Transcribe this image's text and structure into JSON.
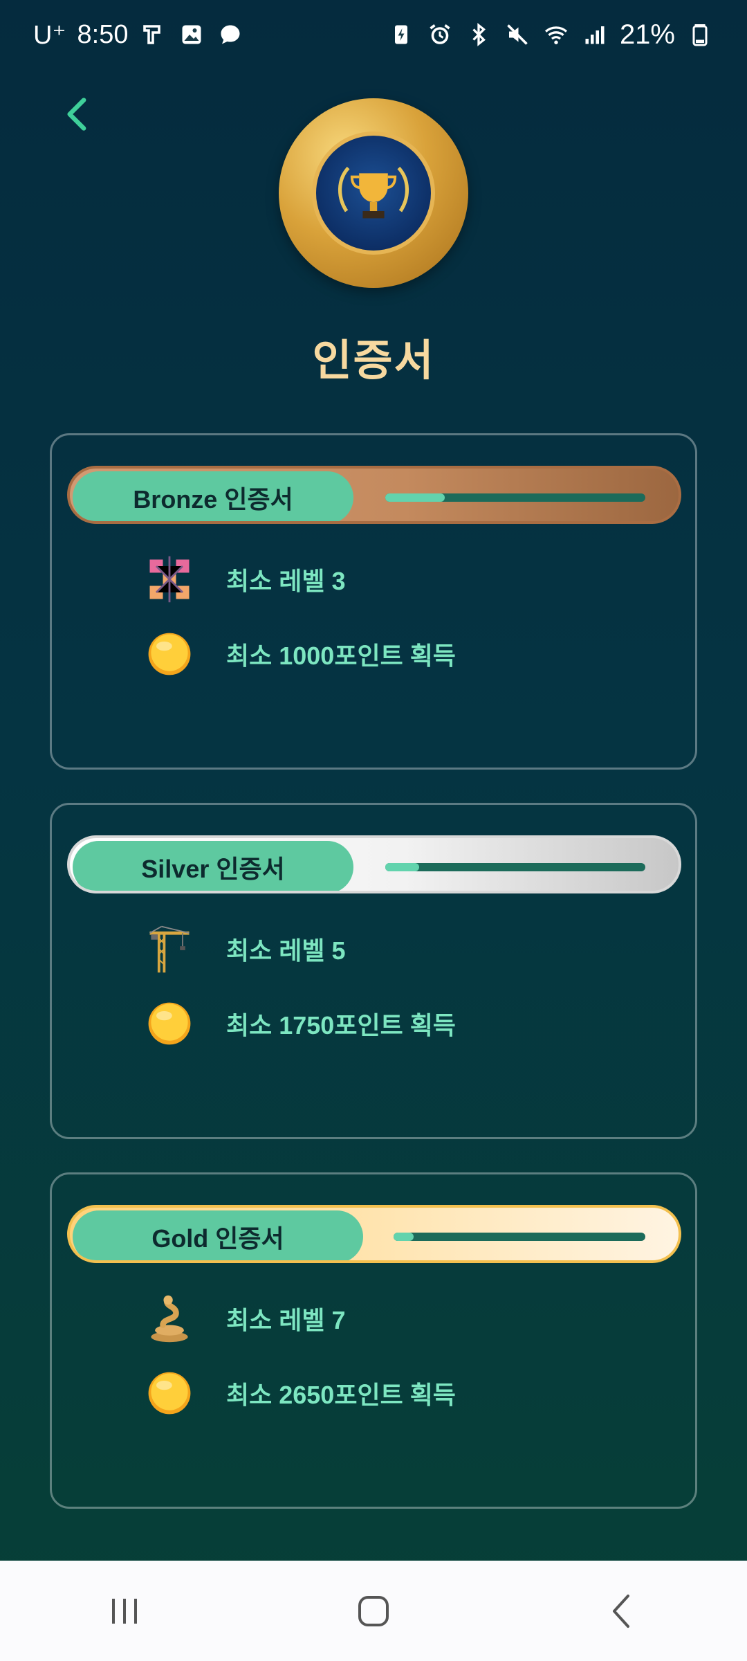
{
  "status_bar": {
    "carrier": "U⁺",
    "time": "8:50",
    "battery": "21%"
  },
  "header": {
    "title": "인증서"
  },
  "certificates": [
    {
      "label": "Bronze 인증서",
      "progress": 0.23,
      "requirements": [
        {
          "icon": "cube-network-icon",
          "text": "최소 레벨 3"
        },
        {
          "icon": "coin-icon",
          "text": "최소 1000포인트 획득"
        }
      ]
    },
    {
      "label": "Silver 인증서",
      "progress": 0.13,
      "requirements": [
        {
          "icon": "crane-icon",
          "text": "최소 레벨 5"
        },
        {
          "icon": "coin-icon",
          "text": "최소 1750포인트 획득"
        }
      ]
    },
    {
      "label": "Gold 인증서",
      "progress": 0.08,
      "requirements": [
        {
          "icon": "snake-icon",
          "text": "최소 레벨 7"
        },
        {
          "icon": "coin-icon",
          "text": "최소 2650포인트 획득"
        }
      ]
    }
  ],
  "colors": {
    "accent": "#5ec9a0",
    "title": "#f7d9a0",
    "requirement_text": "#7de6c1"
  }
}
